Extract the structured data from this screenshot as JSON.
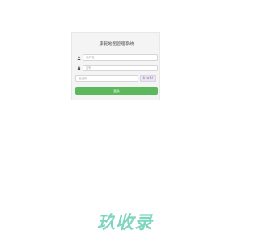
{
  "login": {
    "title": "康复地图管理系统",
    "username_placeholder": "用户名",
    "password_placeholder": "密码",
    "captcha_placeholder": "验证码",
    "captcha_text": "ktnbl",
    "submit_label": "登录"
  },
  "icons": {
    "username": "user-icon",
    "password": "lock-icon"
  },
  "colors": {
    "button": "#5cb85c",
    "watermark": "#7fd6bf"
  },
  "watermark": {
    "text": "玖收录"
  }
}
